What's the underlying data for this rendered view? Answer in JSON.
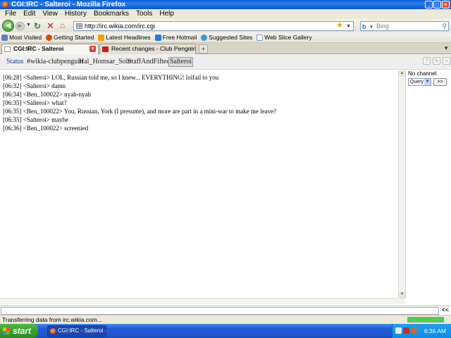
{
  "window": {
    "title": "CGI:IRC - Salteroi - Mozilla Firefox"
  },
  "menu": [
    "File",
    "Edit",
    "View",
    "History",
    "Bookmarks",
    "Tools",
    "Help"
  ],
  "nav": {
    "url": "http://irc.wikia.com/irc.cgi",
    "search_placeholder": "Bing"
  },
  "bookmarks": [
    {
      "label": "Most Visited",
      "color": "#5b7fc7"
    },
    {
      "label": "Getting Started",
      "color": "#d9480f"
    },
    {
      "label": "Latest Headlines",
      "color": "#f4a000"
    },
    {
      "label": "Free Hotmail",
      "color": "#2a78d6"
    },
    {
      "label": "Suggested Sites",
      "color": "#3a9ad9"
    },
    {
      "label": "Web Slice Gallery",
      "color": "#6a9ad9"
    }
  ],
  "tabs": [
    {
      "label": "CGI:IRC - Salteroi"
    },
    {
      "label": "Recent changes - Club Penguin Wiki - T..."
    }
  ],
  "channels": [
    {
      "label": "Status",
      "state": "status"
    },
    {
      "label": "#wikia-clubpenguin",
      "state": "normal"
    },
    {
      "label": "Hal_Homsar_Solo",
      "state": "normal"
    },
    {
      "label": "StaffAndFifteen",
      "state": "normal"
    },
    {
      "label": "Salteroi",
      "state": "active"
    }
  ],
  "messages": [
    "[06:28] <Salteroi> LOL, Russian told me, so I knew... EVERYTHING! lolfail to you",
    "[06:32] <Salteroi> damn",
    "[06:34] <Ben_100022> nyah-nyah",
    "[06:35] <Salteroi> what?",
    "[06:35] <Ben_100022> You, Russian, York (I presume), and more are part in a mini-war to make me leave?",
    "[06:35] <Salteroi> maybe",
    "[06:36] <Ben_100022> screenied"
  ],
  "side": {
    "no_channel": "No channel",
    "query": "Query",
    "go": ">>"
  },
  "input": {
    "send_label": "<<"
  },
  "status": {
    "text": "Transferring data from irc.wikia.com...",
    "progress": 1.0
  },
  "taskbar": {
    "start": "start",
    "task": "CGI:IRC - Salteroi - M...",
    "clock": "6:36 AM"
  }
}
